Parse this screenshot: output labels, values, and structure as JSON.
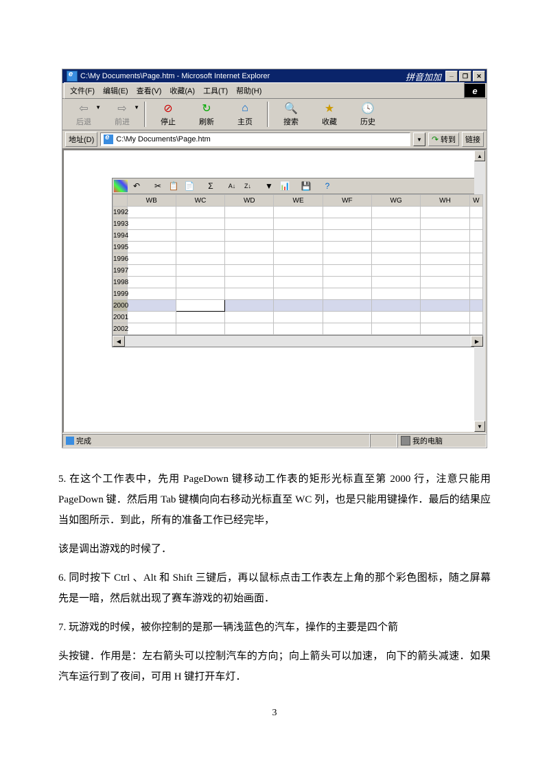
{
  "browser": {
    "title": "C:\\My Documents\\Page.htm - Microsoft Internet Explorer",
    "decor": "拼音加加",
    "menu": [
      "文件(F)",
      "编辑(E)",
      "查看(V)",
      "收藏(A)",
      "工具(T)",
      "帮助(H)"
    ],
    "toolbar": [
      {
        "label": "后退",
        "icon": "⇦"
      },
      {
        "label": "前进",
        "icon": "⇨"
      },
      {
        "label": "停止",
        "icon": "⊘"
      },
      {
        "label": "刷新",
        "icon": "↻"
      },
      {
        "label": "主页",
        "icon": "⌂"
      },
      {
        "label": "搜索",
        "icon": "🔍"
      },
      {
        "label": "收藏",
        "icon": "★"
      },
      {
        "label": "历史",
        "icon": "🕓"
      }
    ],
    "address_label": "地址(D)",
    "address": "C:\\My Documents\\Page.htm",
    "go_label": "转到",
    "links_label": "链接",
    "status_left": "完成",
    "status_right": "我的电脑"
  },
  "spreadsheet": {
    "columns": [
      "WB",
      "WC",
      "WD",
      "WE",
      "WF",
      "WG",
      "WH",
      "W"
    ],
    "rows": [
      "1992",
      "1993",
      "1994",
      "1995",
      "1996",
      "1997",
      "1998",
      "1999",
      "2000",
      "2001",
      "2002"
    ],
    "selected_row": "2000",
    "selected_col": "WC"
  },
  "document": {
    "p1": "5. 在这个工作表中，先用 PageDown 键移动工作表的矩形光标直至第 2000 行，注意只能用 PageDown 键．然后用 Tab 键横向向右移动光标直至 WC 列，也是只能用键操作．最后的结果应当如图所示．到此，所有的准备工作已经完毕，",
    "p2": "该是调出游戏的时候了．",
    "p3": "6. 同时按下 Ctrl 、Alt 和 Shift 三键后，再以鼠标点击工作表左上角的那个彩色图标，随之屏幕先是一暗，然后就出现了赛车游戏的初始画面．",
    "p4": "7. 玩游戏的时候，被你控制的是那一辆浅蓝色的汽车，操作的主要是四个箭",
    "p5": "头按键．作用是：左右箭头可以控制汽车的方向；向上箭头可以加速，  向下的箭头减速．如果汽车运行到了夜间，可用 H 键打开车灯．",
    "page_number": "3"
  }
}
